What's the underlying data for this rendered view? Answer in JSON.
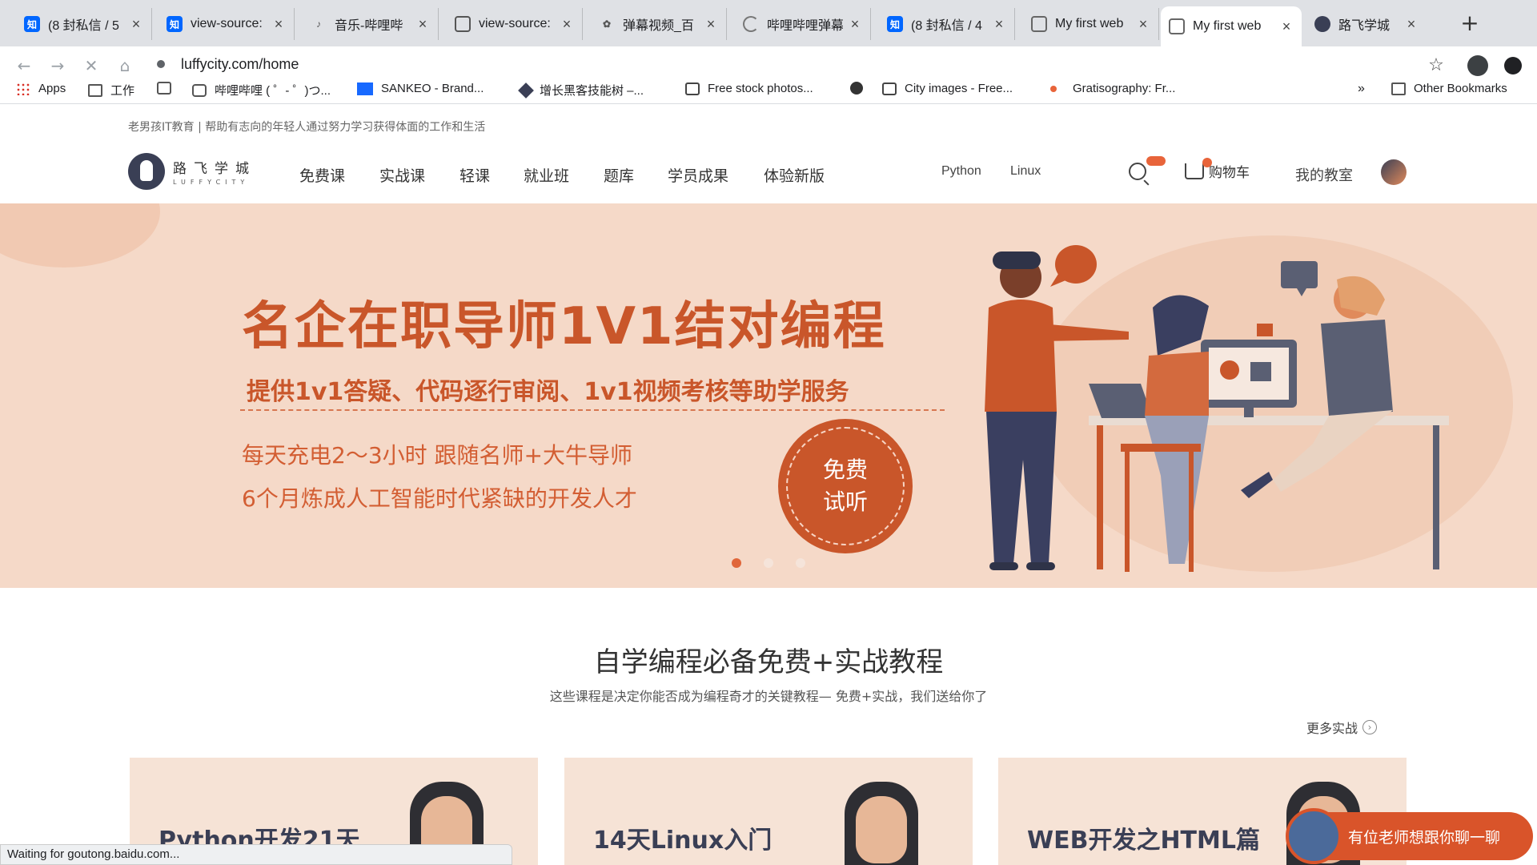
{
  "tabs": [
    {
      "title": "(8 封私信 / 5",
      "icon": "zhihu-icon",
      "color": "#0066ff"
    },
    {
      "title": "view-source:",
      "icon": "zhihu-icon",
      "color": "#0066ff"
    },
    {
      "title": "音乐-哔哩哔",
      "icon": "music-icon",
      "color": "#666666"
    },
    {
      "title": "view-source:",
      "icon": "bilibili-icon",
      "color": "#23ade5"
    },
    {
      "title": "弹幕视频_百",
      "icon": "paw-icon",
      "color": "#555555"
    },
    {
      "title": "哔哩哔哩弹幕",
      "icon": "loading-icon",
      "color": "#888888"
    },
    {
      "title": "(8 封私信 / 4",
      "icon": "zhihu-icon",
      "color": "#0066ff"
    },
    {
      "title": "My first web",
      "icon": "globe-icon",
      "color": "#777777"
    },
    {
      "title": "My first web",
      "icon": "globe-icon",
      "color": "#777777"
    },
    {
      "title": "路飞学城",
      "icon": "luffy-icon",
      "color": "#3a3f55"
    }
  ],
  "url": "luffycity.com/home",
  "bookmarks": {
    "apps": "Apps",
    "items": [
      "工作",
      "哔哩哔哩 ( ゜- ゜)つ...",
      "SANKEO - Brand...",
      "增长黑客技能树 –...",
      "Free stock photos...",
      "City images - Free...",
      "Gratisography: Fr..."
    ],
    "other": "Other Bookmarks"
  },
  "site": {
    "tagline": "老男孩IT教育 | 帮助有志向的年轻人通过努力学习获得体面的工作和生活",
    "logo_cn": "路飞学城",
    "logo_en": "LUFFYCITY",
    "nav": [
      "免费课",
      "实战课",
      "轻课",
      "就业班",
      "题库",
      "学员成果",
      "体验新版"
    ],
    "mini_nav": [
      "Python",
      "Linux"
    ],
    "cart": "购物车",
    "my_classroom": "我的教室"
  },
  "banner": {
    "headline": "名企在职导师1V1结对编程",
    "sub": "提供1v1答疑、代码逐行审阅、1v1视频考核等助学服务",
    "line_a": "每天充电2～3小时  跟随名师+大牛导师",
    "line_b": "6个月炼成人工智能时代紧缺的开发人才",
    "cta_1": "免费",
    "cta_2": "试听",
    "slides": 3,
    "active_slide": 1,
    "accent": "#c9562a",
    "background": "#f5d9c8"
  },
  "section": {
    "title": "自学编程必备免费+实战教程",
    "subtitle": "这些课程是决定你能否成为编程奇才的关键教程— 免费+实战，我们送给你了",
    "more": "更多实战"
  },
  "cards": [
    {
      "title": "Python开发21天"
    },
    {
      "title": "14天Linux入门"
    },
    {
      "title": "WEB开发之HTML篇"
    }
  ],
  "chat": "有位老师想跟你聊一聊",
  "status": "Waiting for goutong.baidu.com..."
}
